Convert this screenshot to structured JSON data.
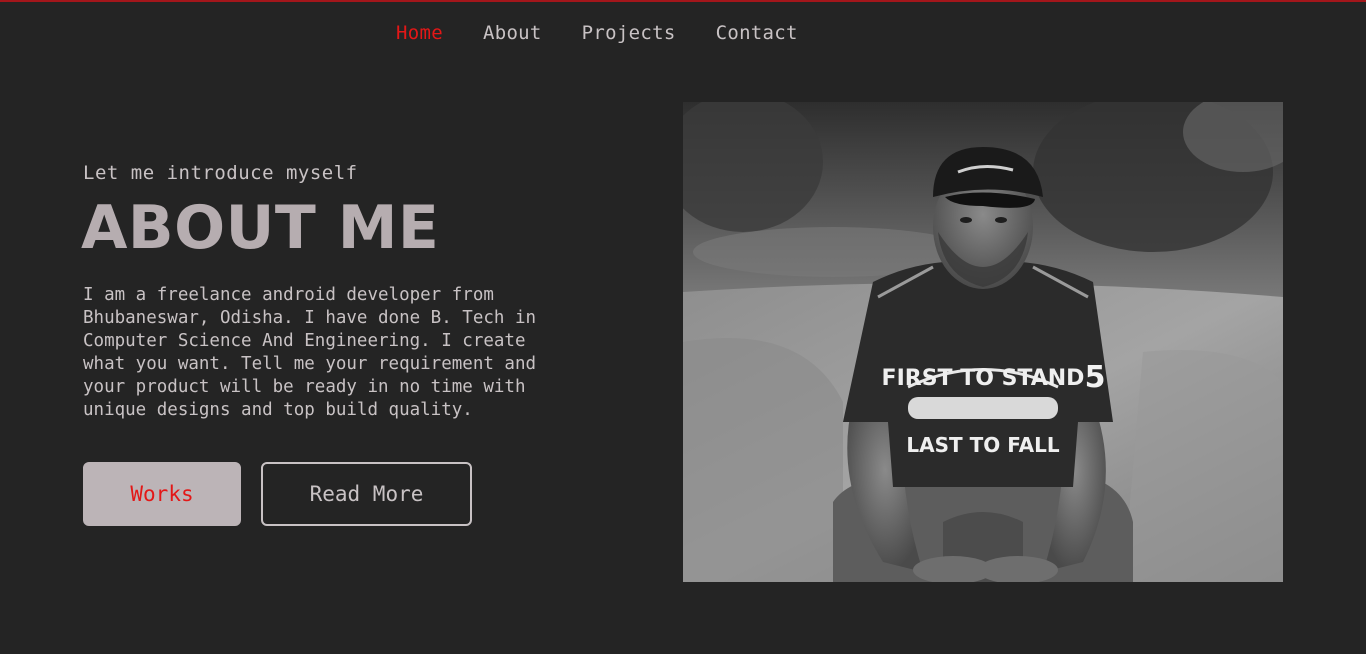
{
  "nav": {
    "items": [
      {
        "label": "Home",
        "active": true
      },
      {
        "label": "About",
        "active": false
      },
      {
        "label": "Projects",
        "active": false
      },
      {
        "label": "Contact",
        "active": false
      }
    ]
  },
  "hero": {
    "intro": "Let me introduce myself",
    "title": "ABOUT ME",
    "description": "I am a freelance android developer from Bhubaneswar, Odisha. I have done B. Tech in Computer Science And Engineering. I create what you want. Tell me your requirement and your product will be ready in no time with unique designs and top build quality.",
    "works_button": "Works",
    "read_more_button": "Read More"
  },
  "photo": {
    "shirt_text_top": "FIRST TO STAND",
    "shirt_text_bottom": "LAST TO FALL",
    "sleeve_text": "5"
  },
  "colors": {
    "background": "#242424",
    "accent": "#e31717",
    "top_border": "#a3161b",
    "text": "#c8c2c4",
    "title": "#b6adb0",
    "works_button_bg": "#bcb4b7"
  }
}
